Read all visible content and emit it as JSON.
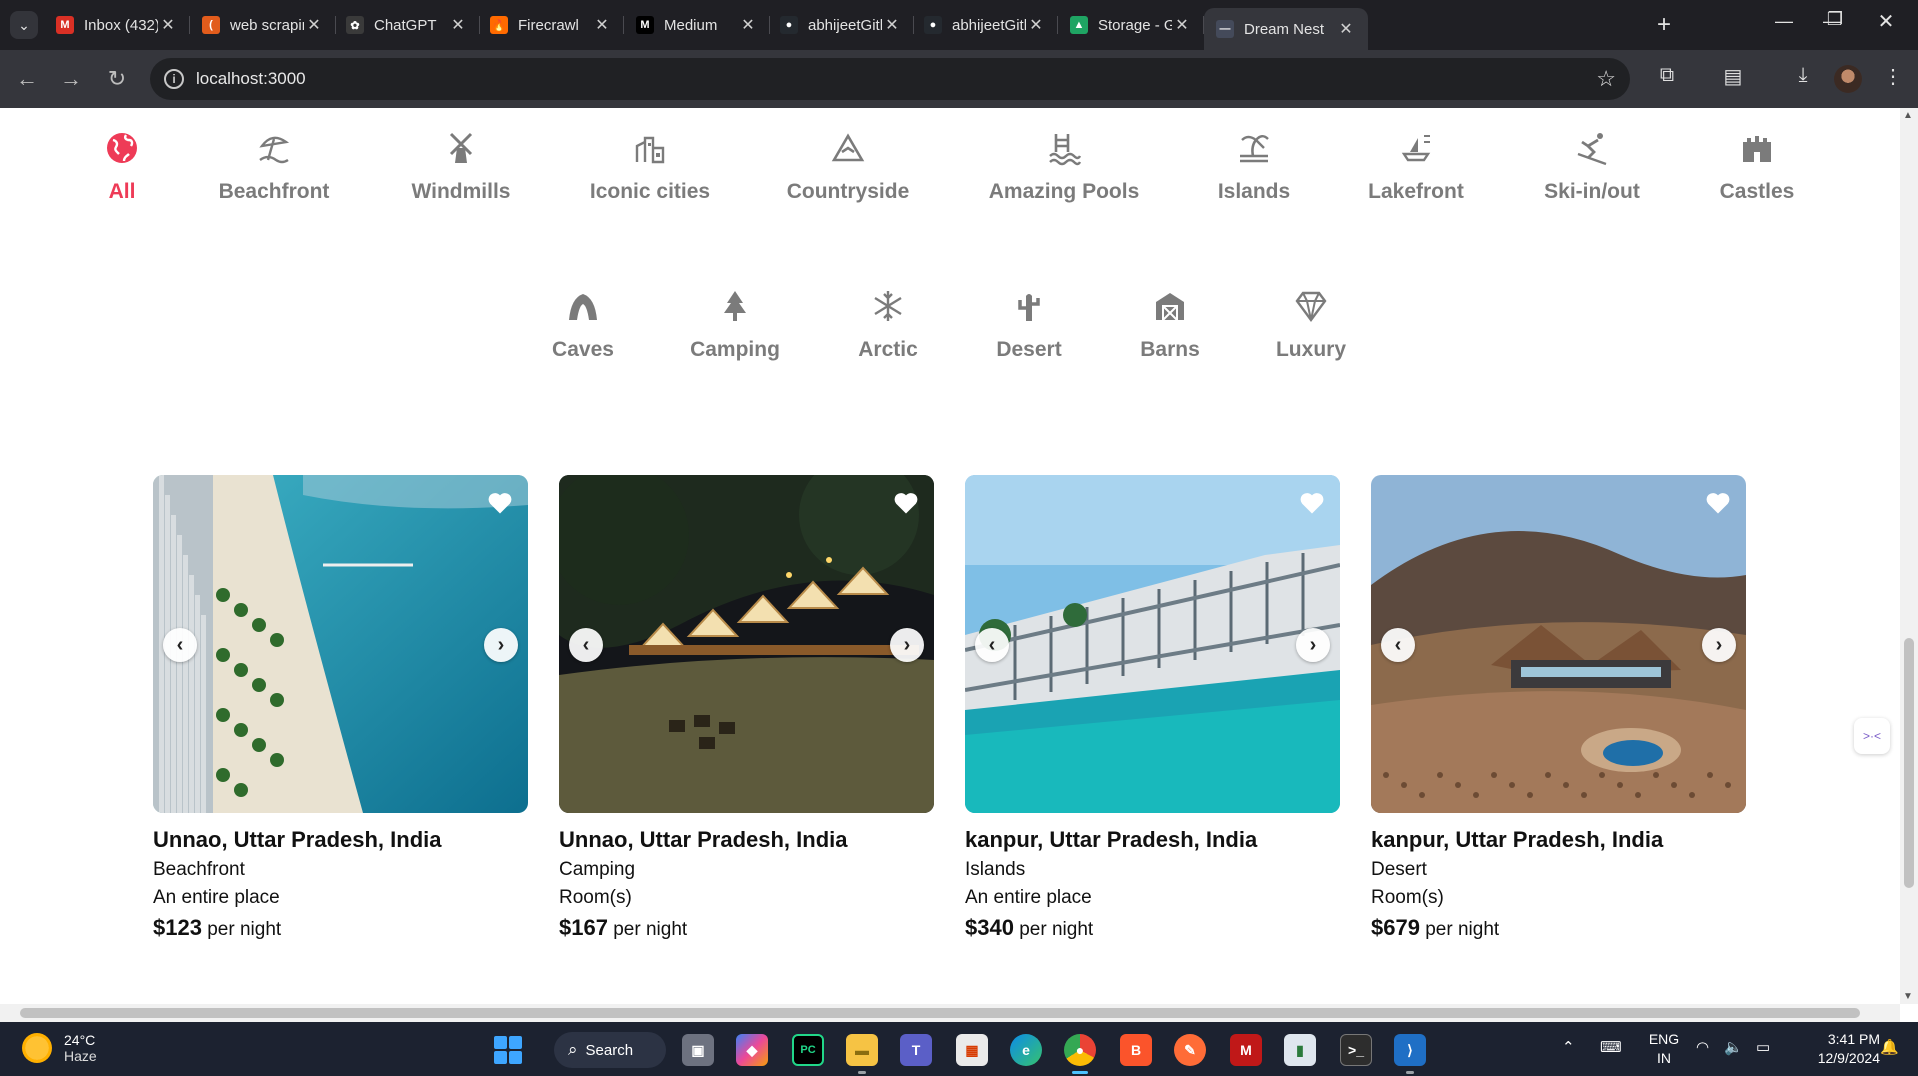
{
  "browser": {
    "tabs": [
      {
        "title": "Inbox (432) -",
        "icon": "gmail-icon",
        "color": "#d93025",
        "glyph": "M"
      },
      {
        "title": "web scraping",
        "icon": "spinner-icon",
        "color": "#e25c1c",
        "glyph": "("
      },
      {
        "title": "ChatGPT",
        "icon": "chatgpt-icon",
        "color": "#3a3a3a",
        "glyph": "✿"
      },
      {
        "title": "Firecrawl",
        "icon": "fire-icon",
        "color": "#ff6a00",
        "glyph": "🔥"
      },
      {
        "title": "Medium",
        "icon": "medium-icon",
        "color": "#000000",
        "glyph": "M"
      },
      {
        "title": "abhijeetGithu",
        "icon": "github-icon",
        "color": "#24292f",
        "glyph": "●"
      },
      {
        "title": "abhijeetGithu",
        "icon": "github-icon",
        "color": "#24292f",
        "glyph": "●"
      },
      {
        "title": "Storage - Goo",
        "icon": "google-drive-icon",
        "color": "#1fa463",
        "glyph": "▲"
      },
      {
        "title": "Dream Nest",
        "icon": "dream-nest-icon",
        "color": "#444a5a",
        "glyph": "—"
      }
    ],
    "active_tab": 8,
    "url": "localhost:3000"
  },
  "categories": [
    {
      "label": "All",
      "icon": "globe-icon",
      "active": true
    },
    {
      "label": "Beachfront",
      "icon": "umbrella-beach-icon"
    },
    {
      "label": "Windmills",
      "icon": "windmill-icon"
    },
    {
      "label": "Iconic cities",
      "icon": "city-icon"
    },
    {
      "label": "Countryside",
      "icon": "mountain-icon"
    },
    {
      "label": "Amazing Pools",
      "icon": "pool-icon"
    },
    {
      "label": "Islands",
      "icon": "island-icon"
    },
    {
      "label": "Lakefront",
      "icon": "boat-icon"
    },
    {
      "label": "Ski-in/out",
      "icon": "skier-icon"
    },
    {
      "label": "Castles",
      "icon": "castle-icon"
    },
    {
      "label": "Caves",
      "icon": "cave-icon"
    },
    {
      "label": "Camping",
      "icon": "tree-icon"
    },
    {
      "label": "Arctic",
      "icon": "snowflake-icon"
    },
    {
      "label": "Desert",
      "icon": "cactus-icon"
    },
    {
      "label": "Barns",
      "icon": "barn-icon"
    },
    {
      "label": "Luxury",
      "icon": "diamond-icon"
    }
  ],
  "listings": [
    {
      "location": "Unnao, Uttar Pradesh, India",
      "category": "Beachfront",
      "type": "An entire place",
      "price": "$123",
      "per": "per night",
      "scene": "beach"
    },
    {
      "location": "Unnao, Uttar Pradesh, India",
      "category": "Camping",
      "type": "Room(s)",
      "price": "$167",
      "per": "per night",
      "scene": "camp"
    },
    {
      "location": "kanpur, Uttar Pradesh, India",
      "category": "Islands",
      "type": "An entire place",
      "price": "$340",
      "per": "per night",
      "scene": "island"
    },
    {
      "location": "kanpur, Uttar Pradesh, India",
      "category": "Desert",
      "type": "Room(s)",
      "price": "$679",
      "per": "per night",
      "scene": "desert"
    }
  ],
  "taskbar": {
    "weather_temp": "24°C",
    "weather_desc": "Haze",
    "search_label": "Search",
    "lang_1": "ENG",
    "lang_2": "IN",
    "time": "3:41 PM",
    "date": "12/9/2024"
  },
  "colors": {
    "accent": "#ee3b57",
    "icon_gray": "#7b7b7b"
  }
}
